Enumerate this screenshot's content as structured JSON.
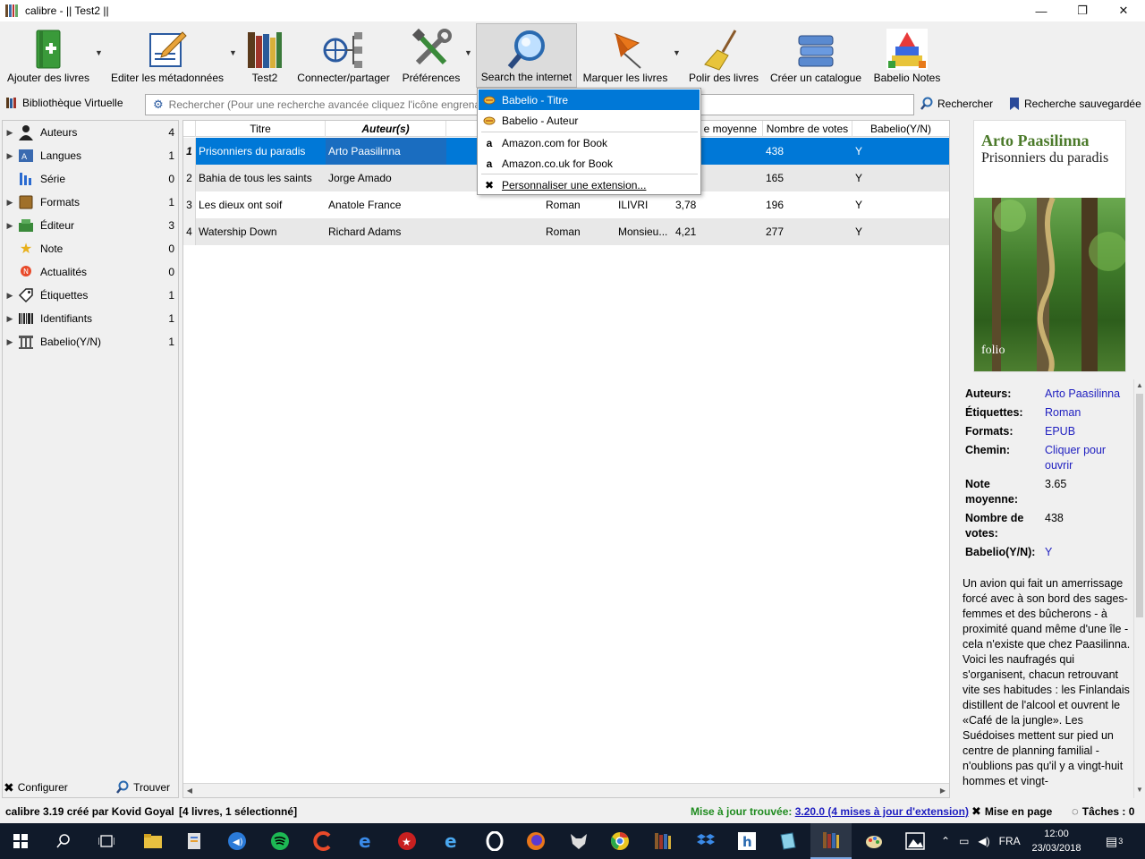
{
  "window": {
    "title": "calibre - || Test2 ||",
    "minimize_glyph": "—",
    "maximize_glyph": "❐",
    "close_glyph": "✕"
  },
  "toolbar": [
    {
      "label": "Ajouter des livres",
      "icon": "add-books-icon"
    },
    {
      "label": "Editer les métadonnées",
      "icon": "edit-metadata-icon"
    },
    {
      "label": "Test2",
      "icon": "library-icon"
    },
    {
      "label": "Connecter/partager",
      "icon": "connect-share-icon"
    },
    {
      "label": "Préférences",
      "icon": "preferences-icon"
    },
    {
      "label": "Search the internet",
      "icon": "search-internet-icon"
    },
    {
      "label": "Marquer les livres",
      "icon": "pin-icon"
    },
    {
      "label": "Polir des livres",
      "icon": "broom-icon"
    },
    {
      "label": "Créer un catalogue",
      "icon": "catalog-icon"
    },
    {
      "label": "Babelio Notes",
      "icon": "babelio-icon"
    }
  ],
  "search": {
    "virtual_library": "Bibliothèque Virtuelle",
    "placeholder": "Rechercher (Pour une recherche avancée cliquez l'icône engrenage à gauche)",
    "search_button": "Rechercher",
    "saved_search": "Recherche sauvegardée"
  },
  "tag_browser": [
    {
      "name": "Auteurs",
      "count": "4",
      "expandable": true,
      "icon": "user-icon"
    },
    {
      "name": "Langues",
      "count": "1",
      "expandable": true,
      "icon": "languages-icon"
    },
    {
      "name": "Série",
      "count": "0",
      "expandable": false,
      "icon": "series-icon"
    },
    {
      "name": "Formats",
      "count": "1",
      "expandable": true,
      "icon": "book-formats-icon"
    },
    {
      "name": "Éditeur",
      "count": "3",
      "expandable": true,
      "icon": "publisher-icon"
    },
    {
      "name": "Note",
      "count": "0",
      "expandable": false,
      "icon": "star-icon"
    },
    {
      "name": "Actualités",
      "count": "0",
      "expandable": false,
      "icon": "news-icon"
    },
    {
      "name": "Étiquettes",
      "count": "1",
      "expandable": true,
      "icon": "tag-icon"
    },
    {
      "name": "Identifiants",
      "count": "1",
      "expandable": true,
      "icon": "barcode-icon"
    },
    {
      "name": "Babelio(Y/N)",
      "count": "1",
      "expandable": true,
      "icon": "column-icon"
    }
  ],
  "left_footer": {
    "configure": "Configurer",
    "find": "Trouver"
  },
  "table": {
    "headers": [
      "Titre",
      "Auteur(s)",
      "",
      "",
      "e moyenne",
      "Nombre de votes",
      "Babelio(Y/N)"
    ],
    "rows": [
      {
        "idx": "1",
        "title": "Prisonniers du paradis",
        "author": "Arto Paasilinna",
        "tags": "",
        "publisher": "",
        "rating": "",
        "votes": "438",
        "babelio": "Y"
      },
      {
        "idx": "2",
        "title": "Bahia de tous les saints",
        "author": "Jorge Amado",
        "tags": "",
        "publisher": "",
        "rating": "",
        "votes": "165",
        "babelio": "Y"
      },
      {
        "idx": "3",
        "title": "Les dieux ont soif",
        "author": "Anatole France",
        "tags": "Roman",
        "publisher": "ILIVRI",
        "rating": "3,78",
        "votes": "196",
        "babelio": "Y"
      },
      {
        "idx": "4",
        "title": "Watership Down",
        "author": "Richard Adams",
        "tags": "Roman",
        "publisher": "Monsieu...",
        "rating": "4,21",
        "votes": "277",
        "babelio": "Y"
      }
    ]
  },
  "menu": [
    {
      "label": "Babelio - Titre",
      "icon": "babelio-small-icon",
      "highlighted": true
    },
    {
      "label": "Babelio - Auteur",
      "icon": "babelio-small-icon",
      "highlighted": false
    },
    {
      "label": "Amazon.com for Book",
      "icon": "amazon-icon",
      "highlighted": false
    },
    {
      "label": "Amazon.co.uk for Book",
      "icon": "amazon-icon",
      "highlighted": false
    },
    {
      "label": "Personnaliser une extension...",
      "icon": "tools-icon",
      "highlighted": false
    }
  ],
  "cover": {
    "author": "Arto Paasilinna",
    "title": "Prisonniers du paradis",
    "imprint": "folio"
  },
  "details": [
    {
      "key": "Auteurs:",
      "value": "Arto Paasilinna",
      "link": true
    },
    {
      "key": "Étiquettes:",
      "value": "Roman",
      "link": true
    },
    {
      "key": "Formats:",
      "value": "EPUB",
      "link": true
    },
    {
      "key": "Chemin:",
      "value": "Cliquer pour ouvrir",
      "link": true
    },
    {
      "key": "Note moyenne:",
      "value": "3.65",
      "link": false
    },
    {
      "key": "Nombre de votes:",
      "value": "438",
      "link": false
    },
    {
      "key": "Babelio(Y/N):",
      "value": "Y",
      "link": true
    }
  ],
  "description": "Un avion qui fait un amerrissage forcé avec à son bord des sages-femmes et des bûcherons - à proximité quand même d'une île - cela n'existe que chez Paasilinna. Voici les naufragés qui s'organisent, chacun retrouvant vite ses habitudes : les Finlandais distillent de l'alcool et ouvrent le «Café de la jungle». Les Suédoises mettent sur pied un centre de planning familial - n'oublions pas qu'il y a vingt-huit hommes et vingt-",
  "status": {
    "version": "calibre 3.19 créé par Kovid Goyal",
    "count": "[4 livres, 1 sélectionné]",
    "update_prefix": "Mise à jour trouvée: ",
    "update_link": "3.20.0 (4 mises à jour d'extension)",
    "layout": "Mise en page",
    "jobs": "Tâches : 0"
  },
  "taskbar": {
    "language": "FRA",
    "time": "12:00",
    "date": "23/03/2018",
    "notifications": "3"
  },
  "colors": {
    "selection": "#0078d7",
    "link": "#2020c0",
    "update": "#1e8b1e"
  }
}
